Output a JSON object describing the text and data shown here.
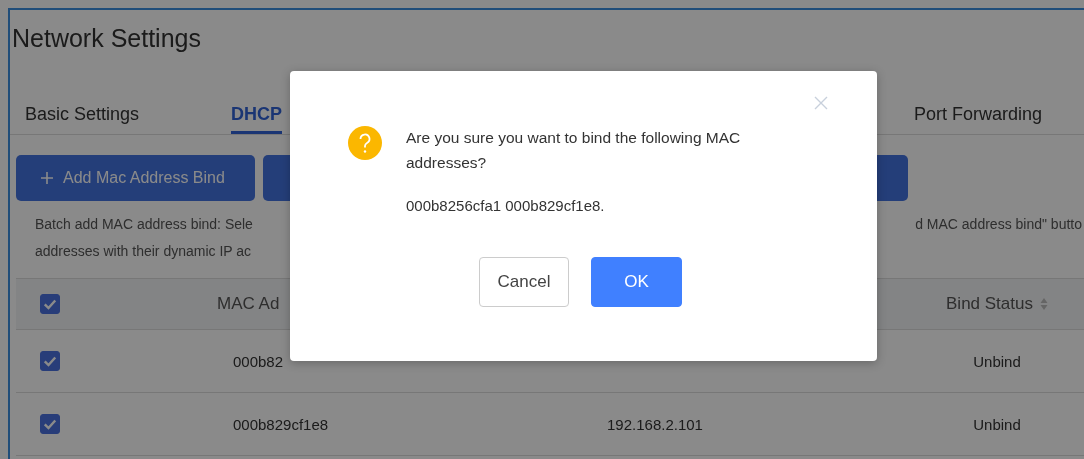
{
  "page_title": "Network Settings",
  "tabs": [
    {
      "label": "Basic Settings",
      "selected": false
    },
    {
      "label": "DHCP",
      "selected": true
    },
    {
      "label": "Port Forwarding",
      "selected": false
    }
  ],
  "toolbar": [
    {
      "label": "Add Mac Address Bind",
      "kind": "add"
    },
    {
      "kind": "plain"
    }
  ],
  "description": {
    "left_lines": [
      "Batch add MAC address bind: Sele",
      "addresses with their dynamic IP ac"
    ],
    "right_fragment": "d MAC address bind\" butto"
  },
  "table": {
    "header_checked": true,
    "columns": [
      {
        "label": "MAC Ad"
      },
      {
        "label": "Bind Status"
      }
    ],
    "rows": [
      {
        "checked": true,
        "mac": "000b82",
        "status": "Unbind"
      },
      {
        "checked": true,
        "mac": "000b829cf1e8",
        "ip": "192.168.2.101",
        "status": "Unbind"
      }
    ]
  },
  "dialog": {
    "message": "Are you sure you want to bind the following MAC addresses?",
    "detail": "000b8256cfa1 000b829cf1e8.",
    "buttons": [
      {
        "label": "Cancel",
        "kind": "secondary"
      },
      {
        "label": "OK",
        "kind": "primary"
      }
    ]
  }
}
